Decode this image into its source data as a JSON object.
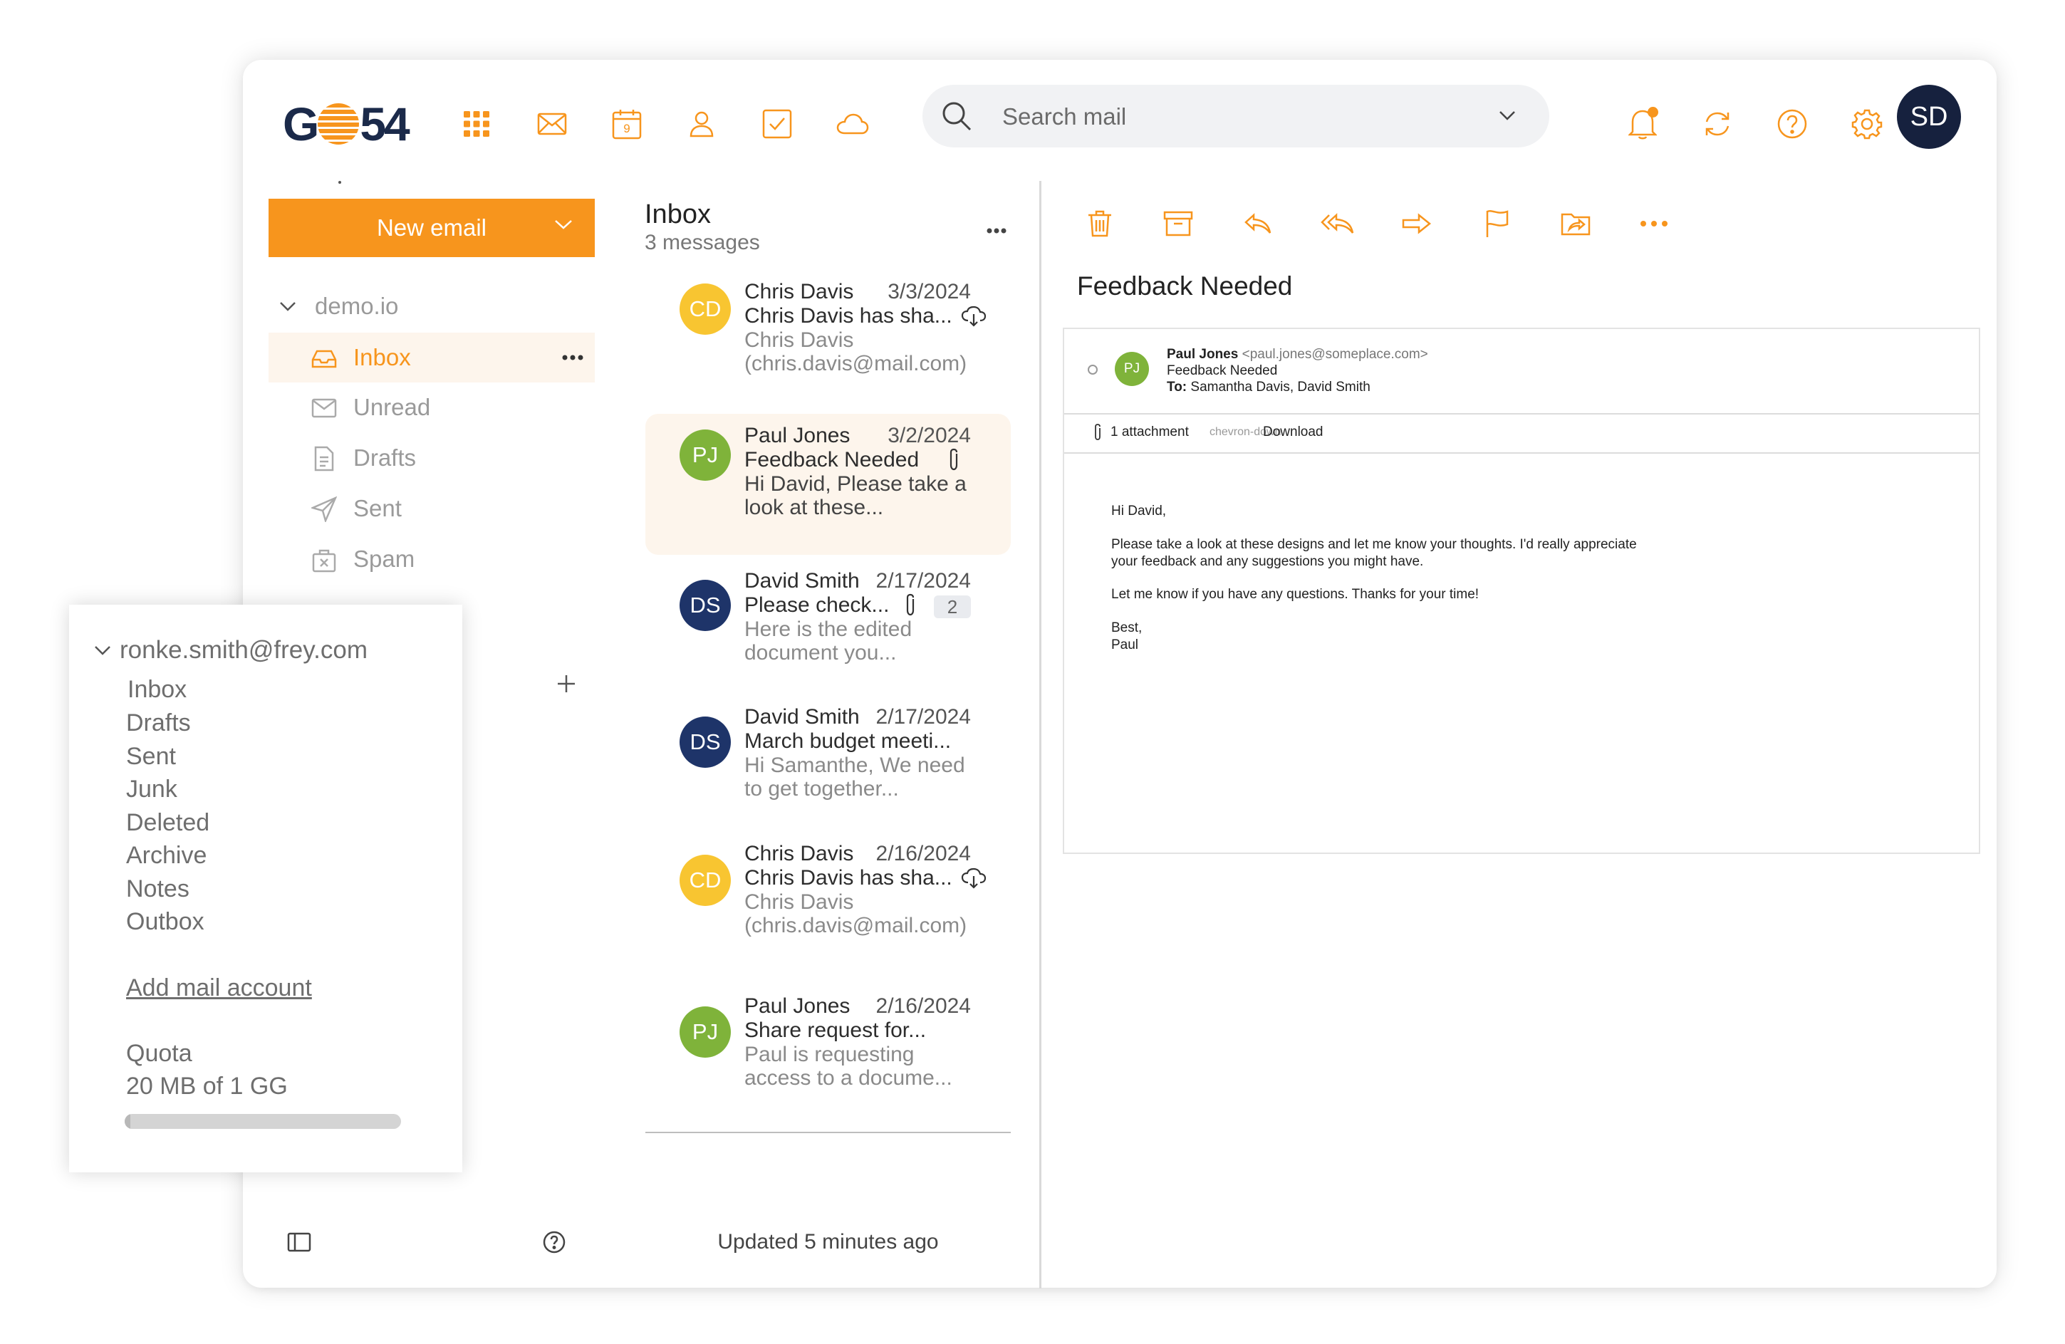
{
  "app": {
    "logo_left": "G",
    "logo_right": "54",
    "colors": {
      "accent": "#f7951d",
      "navy": "#16213e",
      "cd_avatar": "#f8c531",
      "pj_avatar": "#7fb33a",
      "ds_avatar": "#1e3469"
    }
  },
  "topbar": {
    "apps": [
      "apps-grid-icon",
      "mail-icon",
      "calendar-icon",
      "contacts-icon",
      "tasks-icon",
      "cloud-icon"
    ],
    "calendar_day": "9",
    "search_placeholder": "Search mail",
    "user_initials": "SD"
  },
  "sidebar": {
    "new_email_label": "New email",
    "account": "demo.io",
    "folders": [
      {
        "label": "Inbox",
        "icon": "inbox-icon"
      },
      {
        "label": "Unread",
        "icon": "envelope-icon"
      },
      {
        "label": "Drafts",
        "icon": "document-icon"
      },
      {
        "label": "Sent",
        "icon": "send-icon"
      },
      {
        "label": "Spam",
        "icon": "spam-icon"
      }
    ]
  },
  "account_popup": {
    "email": "ronke.smith@frey.com",
    "folders": [
      "Inbox",
      "Drafts",
      "Sent",
      "Junk",
      "Deleted",
      "Archive",
      "Notes",
      "Outbox"
    ],
    "add_account": "Add mail account",
    "quota_label": "Quota",
    "quota_value": "20 MB of 1 GG",
    "quota_fraction": 0.02
  },
  "message_list": {
    "title": "Inbox",
    "count": "3 messages",
    "footer": "Updated 5 minutes ago",
    "messages": [
      {
        "initials": "CD",
        "from": "Chris Davis",
        "date": "3/3/2024",
        "subject": "Chris Davis has sha...",
        "preview": "Chris Davis (chris.davis@mail.com)",
        "icon": "cloud-download-icon"
      },
      {
        "initials": "PJ",
        "from": "Paul Jones",
        "date": "3/2/2024",
        "subject": "Feedback Needed",
        "preview": "Hi David, Please take a look at these...",
        "icon": "paperclip-icon"
      },
      {
        "initials": "DS",
        "from": "David Smith",
        "date": "2/17/2024",
        "subject": "Please check...",
        "preview": "Here is the edited document you...",
        "icon": "paperclip-icon",
        "thread_count": "2"
      },
      {
        "initials": "DS",
        "from": "David Smith",
        "date": "2/17/2024",
        "subject": "March budget meeti...",
        "preview": "Hi Samanthe, We need to get together..."
      },
      {
        "initials": "CD",
        "from": "Chris Davis",
        "date": "2/16/2024",
        "subject": "Chris Davis has sha...",
        "preview": "Chris Davis (chris.davis@mail.com)",
        "icon": "cloud-download-icon"
      },
      {
        "initials": "PJ",
        "from": "Paul Jones",
        "date": "2/16/2024",
        "subject": "Share request for...",
        "preview": "Paul is requesting access to a docume..."
      }
    ]
  },
  "reader": {
    "toolbar": [
      "delete-icon",
      "archive-icon",
      "reply-icon",
      "reply-all-icon",
      "forward-icon",
      "flag-icon",
      "move-folder-icon",
      "more-icon"
    ],
    "title": "Feedback Needed",
    "sender_initials": "PJ",
    "sender_name": "Paul Jones",
    "sender_email": "<paul.jones@someplace.com>",
    "subject": "Feedback Needed",
    "to_label": "To:",
    "to": "Samantha Davis, David Smith",
    "attachment_label": "1 attachment",
    "attachment_chevron": "chevron-down",
    "download_label": "Download",
    "body": [
      "Hi David,",
      "Please take a look at these designs and let me know your thoughts. I'd really appreciate your feedback and any suggestions you might have.",
      "Let me know if you have any questions. Thanks for your time!",
      "Best,",
      "Paul"
    ]
  }
}
